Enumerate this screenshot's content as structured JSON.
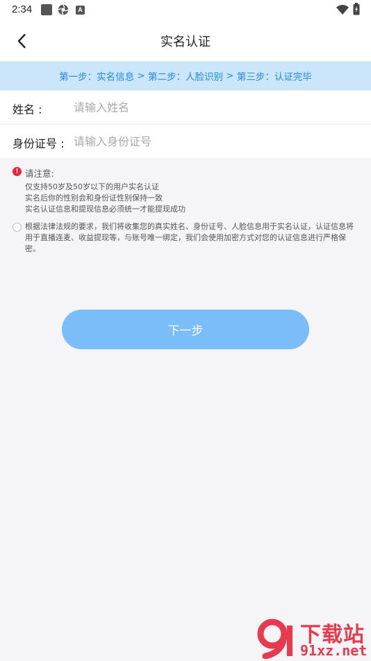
{
  "status_bar": {
    "time": "2:34",
    "icons": [
      "square-notification-icon",
      "aperture-icon",
      "a-icon",
      "wifi-icon",
      "battery-icon"
    ],
    "a_icon_text": "A"
  },
  "header": {
    "title": "实名认证",
    "back_icon": "chevron-left-icon"
  },
  "steps": {
    "step1": "第一步：实名信息",
    "sep1": " > ",
    "step2": "第二步：人脸识别",
    "sep2": " > ",
    "step3": "第三步：认证完毕",
    "color": "#1f8ae6",
    "background": "#cbe6fb"
  },
  "form": {
    "name_label": "姓名 :",
    "name_placeholder": "请输入姓名",
    "name_value": "",
    "id_label": "身份证号 :",
    "id_placeholder": "请输入身份证号",
    "id_value": ""
  },
  "notice": {
    "icon_text": "!",
    "title": "请注意:",
    "lines": [
      "仅支持50岁及50岁以下的用户实名认证",
      "实名后你的性别会和身份证性别保持一致",
      "实名认证信息和提现信息必须统一才能提现成功"
    ]
  },
  "agreement": {
    "text": "根据法律法规的要求，我们将收集您的真实姓名、身份证号、人脸信息用于实名认证，认证信息将用于直播连麦、收益提现等，与账号唯一绑定，我们会使用加密方式对您的认证信息进行严格保密。",
    "checked": false
  },
  "next_button": {
    "label": "下一步",
    "color": "#7bbdf8"
  },
  "watermark": {
    "title": "下载站",
    "url": "91xz.net",
    "logo_text": "9",
    "color": "#e83a4c"
  }
}
